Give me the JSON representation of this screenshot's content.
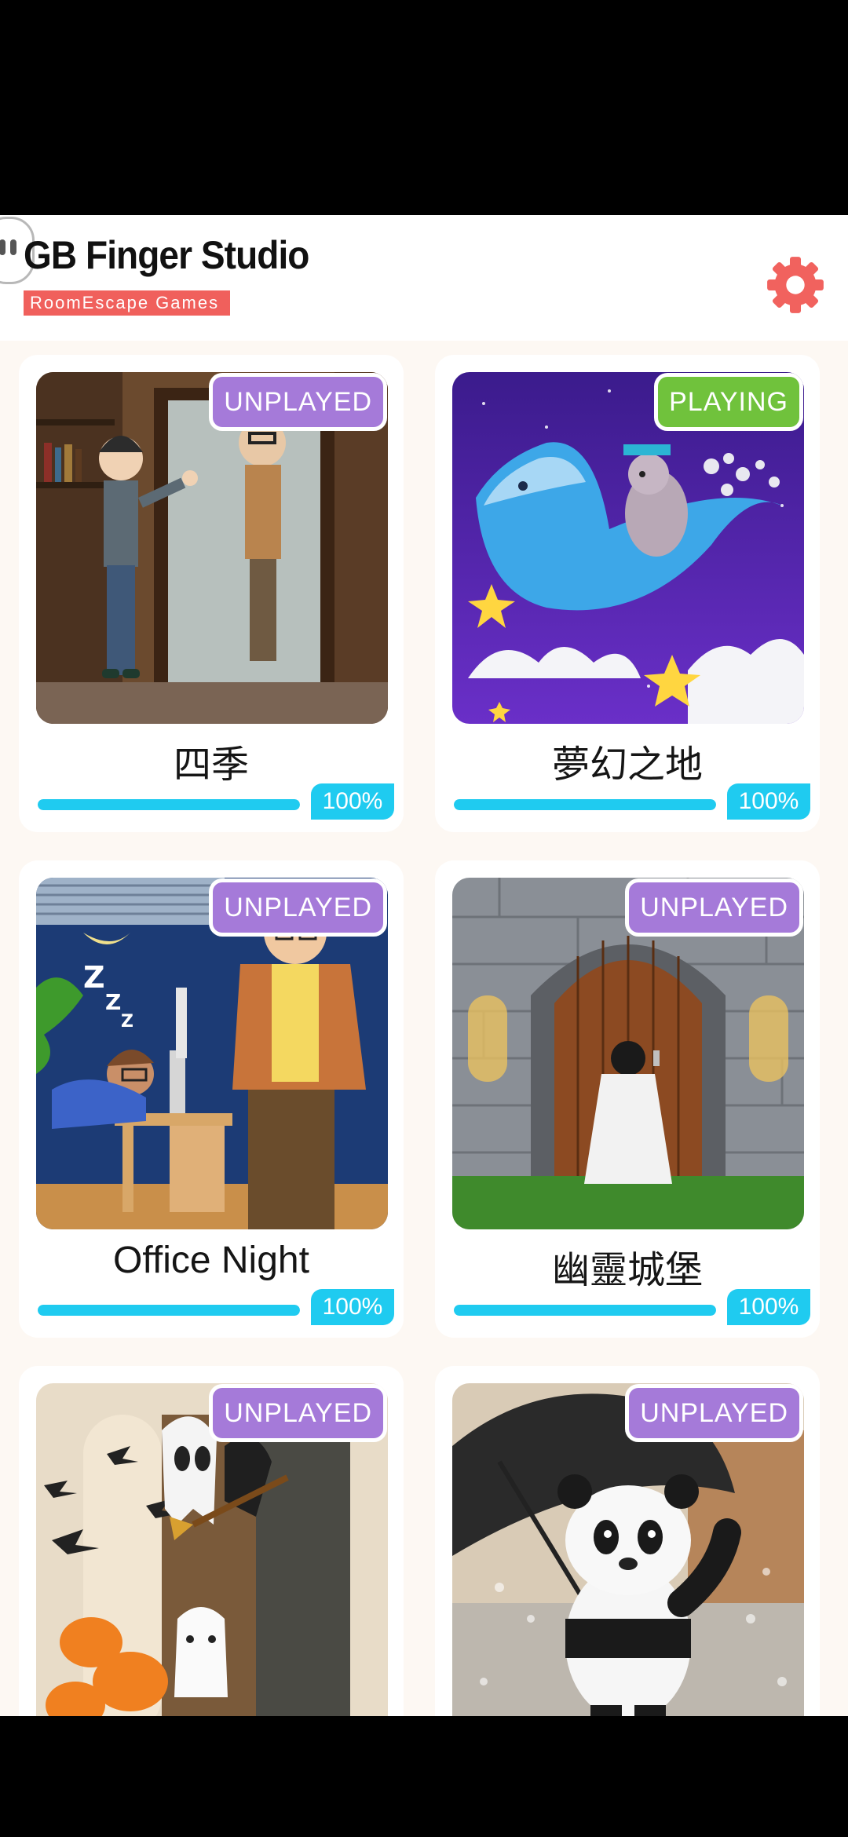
{
  "brand": {
    "title": "GB Finger Studio",
    "subtitle": "RoomEscape  Games"
  },
  "header": {
    "settings_icon": "gear-icon"
  },
  "colors": {
    "background": "#fdf8f3",
    "brand_red": "#f0605c",
    "unplayed": "#a57ad9",
    "playing": "#70c23c",
    "progress": "#1fcbf0"
  },
  "games": [
    {
      "title": "四季",
      "status": "UNPLAYED",
      "progress": 1.0,
      "progress_label": "100%",
      "scene": "mirror-room"
    },
    {
      "title": "夢幻之地",
      "status": "PLAYING",
      "progress": 1.0,
      "progress_label": "100%",
      "scene": "whale-cat-night"
    },
    {
      "title": "Office Night",
      "status": "UNPLAYED",
      "progress": 1.0,
      "progress_label": "100%",
      "scene": "office-night"
    },
    {
      "title": "幽靈城堡",
      "status": "UNPLAYED",
      "progress": 1.0,
      "progress_label": "100%",
      "scene": "castle-door"
    },
    {
      "title": "",
      "status": "UNPLAYED",
      "progress": null,
      "progress_label": "",
      "scene": "halloween-room"
    },
    {
      "title": "",
      "status": "UNPLAYED",
      "progress": null,
      "progress_label": "",
      "scene": "panda-umbrella"
    }
  ]
}
